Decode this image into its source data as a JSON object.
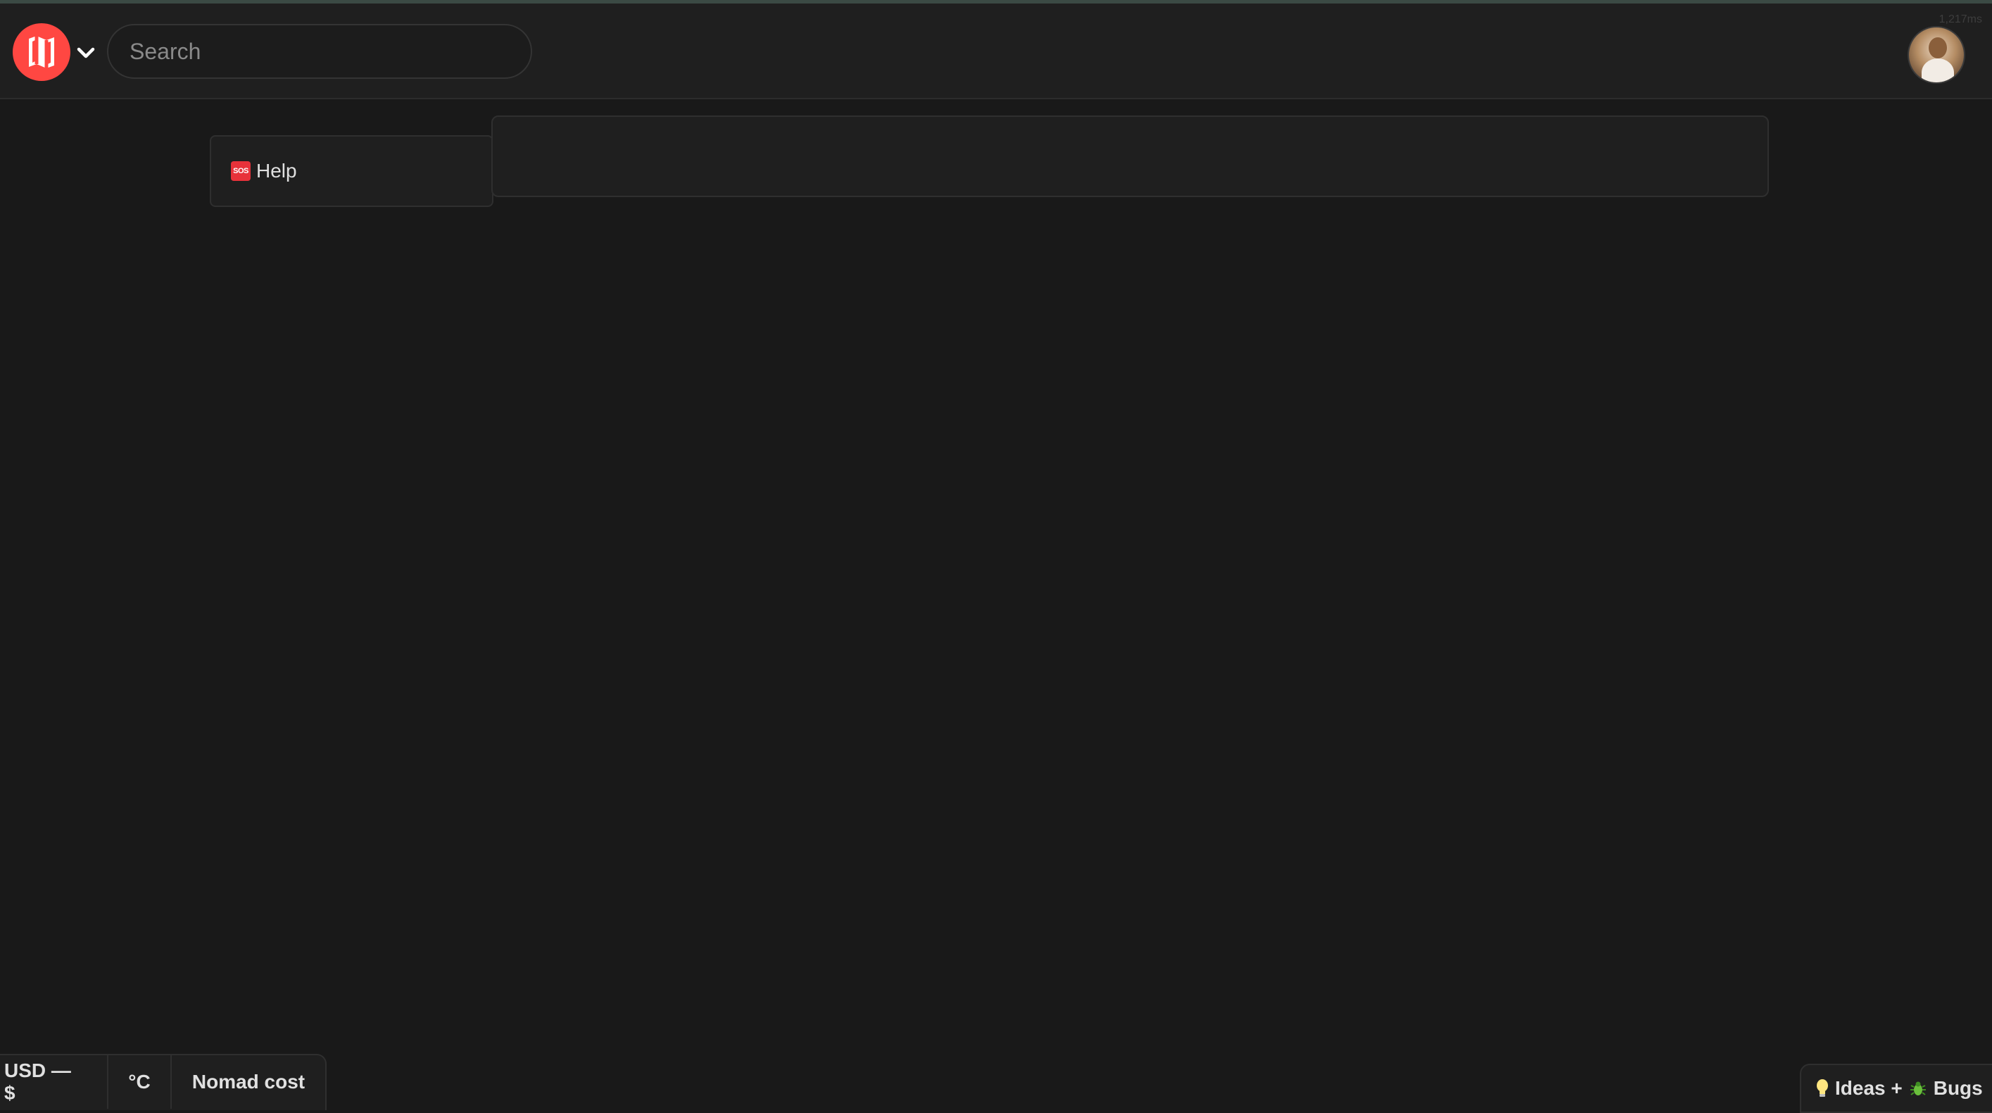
{
  "header": {
    "logo_icon": "nomads-map-logo-icon",
    "menu_icon": "chevron-down-icon",
    "search": {
      "placeholder": "Search",
      "value": ""
    },
    "corner_text": "1,217ms",
    "avatar_icon": "user-avatar"
  },
  "help_card": {
    "icon": "sos-icon",
    "label": "Help"
  },
  "footer": {
    "currency": "USD — $",
    "temperature": "°C",
    "nomad_cost": "Nomad cost",
    "ideas_label": "Ideas +",
    "bugs_label": "Bugs",
    "ideas_icon": "lightbulb-icon",
    "bugs_icon": "bug-icon"
  },
  "colors": {
    "background": "#191919",
    "surface": "#1f1f1f",
    "border": "#2f2f2f",
    "brand": "#ff4742",
    "sos": "#e8323a"
  }
}
